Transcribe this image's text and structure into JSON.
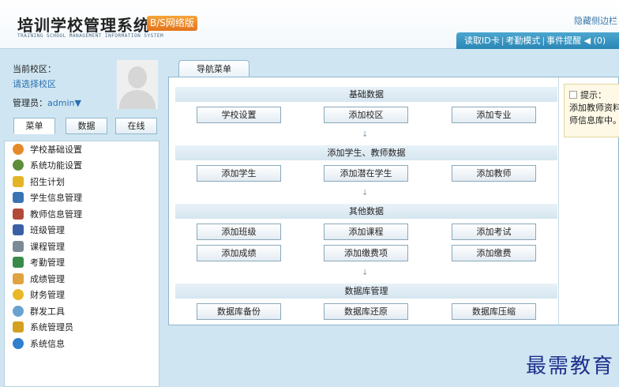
{
  "header": {
    "title": "培训学校管理系统",
    "badge": "B/S网络版",
    "subtitle": "TRAINING SCHOOL MANAGEMENT INFORMATION SYSTEM",
    "hide_sidebar": "隐藏侧边栏",
    "toolbar": {
      "read_card": "读取ID卡",
      "attendance_mode": "考勤模式",
      "event_reminder": "事件提醒 ◀ (0)",
      "separator": "|"
    }
  },
  "profile": {
    "campus_label": "当前校区：",
    "campus_select": "请选择校区",
    "admin_label": "管理员：",
    "admin_user": "admin▼"
  },
  "tabs": {
    "menu": "菜单",
    "data": "数据",
    "online": "在线"
  },
  "menu_items": [
    {
      "label": "学校基础设置",
      "icon": "palette-icon",
      "color": "#e58a2a"
    },
    {
      "label": "系统功能设置",
      "icon": "gear-icon",
      "color": "#5c8d3a"
    },
    {
      "label": "招生计划",
      "icon": "flag-icon",
      "color": "#e3b526"
    },
    {
      "label": "学生信息管理",
      "icon": "student-card-icon",
      "color": "#3a73b5"
    },
    {
      "label": "教师信息管理",
      "icon": "teacher-card-icon",
      "color": "#b24a3a"
    },
    {
      "label": "班级管理",
      "icon": "book-icon",
      "color": "#3a5fa5"
    },
    {
      "label": "课程管理",
      "icon": "list-icon",
      "color": "#7a8a96"
    },
    {
      "label": "考勤管理",
      "icon": "pencil-icon",
      "color": "#3a8a4a"
    },
    {
      "label": "成绩管理",
      "icon": "note-icon",
      "color": "#e0a340"
    },
    {
      "label": "财务管理",
      "icon": "coin-icon",
      "color": "#e8b828"
    },
    {
      "label": "群发工具",
      "icon": "chat-icon",
      "color": "#6aa2cf"
    },
    {
      "label": "系统管理员",
      "icon": "key-icon",
      "color": "#d4a020"
    },
    {
      "label": "系统信息",
      "icon": "info-icon",
      "color": "#2f7fcf"
    }
  ],
  "nav": {
    "tab_label": "导航菜单",
    "sections": [
      {
        "title": "基础数据",
        "buttons": [
          "学校设置",
          "添加校区",
          "添加专业"
        ]
      },
      {
        "title": "添加学生、教师数据",
        "buttons": [
          "添加学生",
          "添加潜在学生",
          "添加教师"
        ]
      },
      {
        "title": "其他数据",
        "buttons": [
          "添加班级",
          "添加课程",
          "添加考试",
          "添加成绩",
          "添加缴费项",
          "添加缴费"
        ]
      },
      {
        "title": "数据库管理",
        "buttons": [
          "数据库备份",
          "数据库还原",
          "数据库压缩"
        ]
      }
    ],
    "arrow": "↓"
  },
  "tip": {
    "title": "提示：",
    "line1": "添加教师资料",
    "line2": "师信息库中。"
  },
  "watermark": "最需教育"
}
